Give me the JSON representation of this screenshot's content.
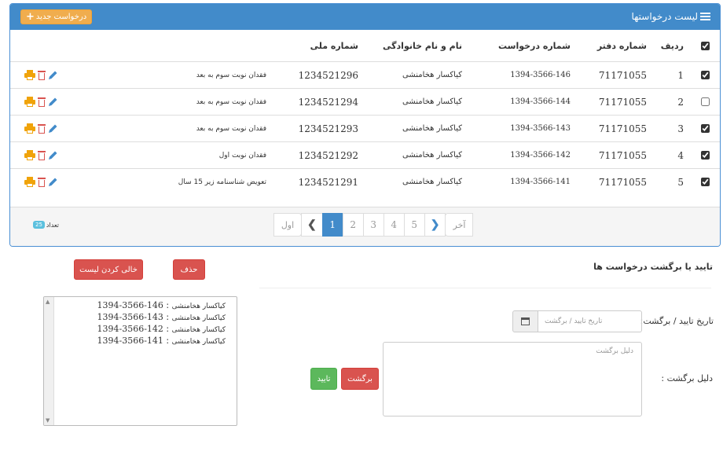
{
  "panel": {
    "title": "لیست درخواستها",
    "new_request": "درخواست جدید"
  },
  "table": {
    "headers": {
      "row_no": "ردیف",
      "office_no": "شماره دفتر",
      "request_no": "شماره درخواست",
      "full_name": "نام و نام خانوادگی",
      "national_id": "شماره ملی"
    },
    "rows": [
      {
        "checked": true,
        "row_no": "1",
        "office_no": "71171055",
        "request_no": "1394-3566-146",
        "full_name": "کیاکسار هخامنشی",
        "national_id": "1234521296",
        "description": "فقدان نوبت سوم به بعد"
      },
      {
        "checked": false,
        "row_no": "2",
        "office_no": "71171055",
        "request_no": "1394-3566-144",
        "full_name": "کیاکسار هخامنشی",
        "national_id": "1234521294",
        "description": "فقدان نوبت سوم به بعد"
      },
      {
        "checked": true,
        "row_no": "3",
        "office_no": "71171055",
        "request_no": "1394-3566-143",
        "full_name": "کیاکسار هخامنشی",
        "national_id": "1234521293",
        "description": "فقدان نوبت سوم به بعد"
      },
      {
        "checked": true,
        "row_no": "4",
        "office_no": "71171055",
        "request_no": "1394-3566-142",
        "full_name": "کیاکسار هخامنشی",
        "national_id": "1234521292",
        "description": "فقدان نوبت اول"
      },
      {
        "checked": true,
        "row_no": "5",
        "office_no": "71171055",
        "request_no": "1394-3566-141",
        "full_name": "کیاکسار هخامنشی",
        "national_id": "1234521291",
        "description": "تعویض شناسنامه زیر 15 سال"
      }
    ]
  },
  "footer": {
    "count_label": "تعداد",
    "count_value": "25"
  },
  "pagination": {
    "last": "آخر",
    "pages": [
      "5",
      "4",
      "3",
      "2",
      "1"
    ],
    "active_page": "1",
    "first": "اول"
  },
  "approval": {
    "section_title": "تایید یا برگشت درخواست ها",
    "delete_button": "حذف",
    "clear_list_button": "خالی کردن لیست",
    "date_label": "تاریخ تایید / برگشت:",
    "date_placeholder": "تاریخ تایید / برگشت",
    "reason_label": "دلیل برگشت :",
    "reason_placeholder": "دلیل برگشت",
    "reject_button": "برگشت",
    "approve_button": "تایید"
  },
  "selected_list": [
    {
      "request_no": "1394-3566-146",
      "name": "کیاکسار هخامنشی"
    },
    {
      "request_no": "1394-3566-143",
      "name": "کیاکسار هخامنشی"
    },
    {
      "request_no": "1394-3566-142",
      "name": "کیاکسار هخامنشی"
    },
    {
      "request_no": "1394-3566-141",
      "name": "کیاکسار هخامنشی"
    }
  ],
  "colors": {
    "primary": "#428bca",
    "warning": "#f0ad4e",
    "danger": "#d9534f",
    "success": "#5cb85c",
    "info": "#5bc0de"
  }
}
